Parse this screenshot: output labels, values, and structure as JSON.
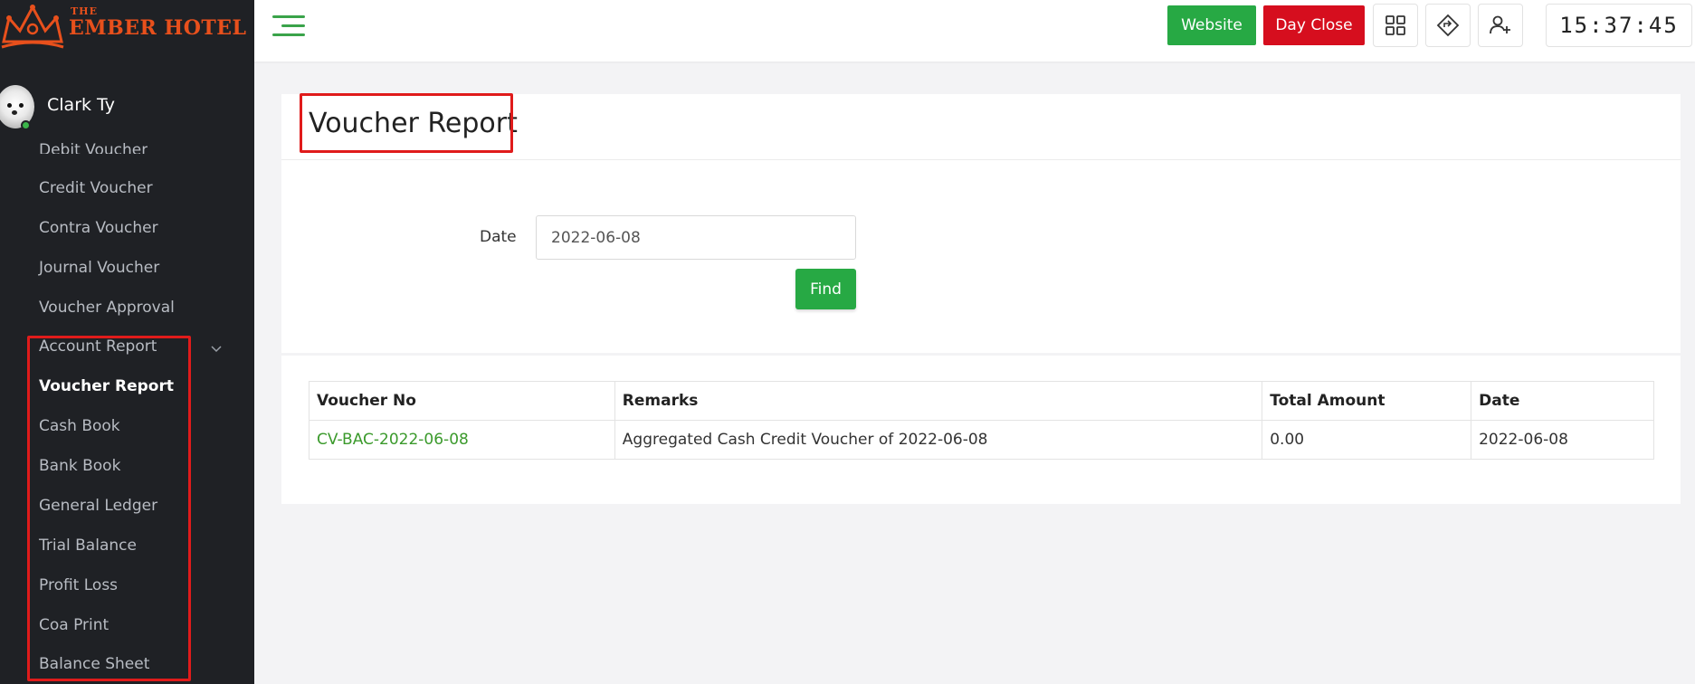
{
  "brand": {
    "small": "THE",
    "name": "EMBER HOTEL"
  },
  "user": {
    "name": "Clark Ty"
  },
  "sidebar": {
    "items": [
      {
        "label": "Debit Voucher"
      },
      {
        "label": "Credit Voucher"
      },
      {
        "label": "Contra Voucher"
      },
      {
        "label": "Journal Voucher"
      },
      {
        "label": "Voucher Approval"
      },
      {
        "label": "Account Report"
      },
      {
        "label": "Voucher Report"
      },
      {
        "label": "Cash Book"
      },
      {
        "label": "Bank Book"
      },
      {
        "label": "General Ledger"
      },
      {
        "label": "Trial Balance"
      },
      {
        "label": "Profit Loss"
      },
      {
        "label": "Coa Print"
      },
      {
        "label": "Balance Sheet"
      }
    ]
  },
  "topbar": {
    "website_label": "Website",
    "dayclose_label": "Day Close",
    "clock": "15:37:45",
    "colors": {
      "website": "#27a944",
      "dayclose": "#d60e1e"
    }
  },
  "page": {
    "title": "Voucher Report",
    "date_label": "Date",
    "date_value": "2022-06-08",
    "find_label": "Find"
  },
  "table": {
    "headers": [
      "Voucher No",
      "Remarks",
      "Total Amount",
      "Date"
    ],
    "rows": [
      [
        "CV-BAC-2022-06-08",
        "Aggregated Cash Credit Voucher of 2022-06-08",
        "0.00",
        "2022-06-08"
      ]
    ]
  }
}
